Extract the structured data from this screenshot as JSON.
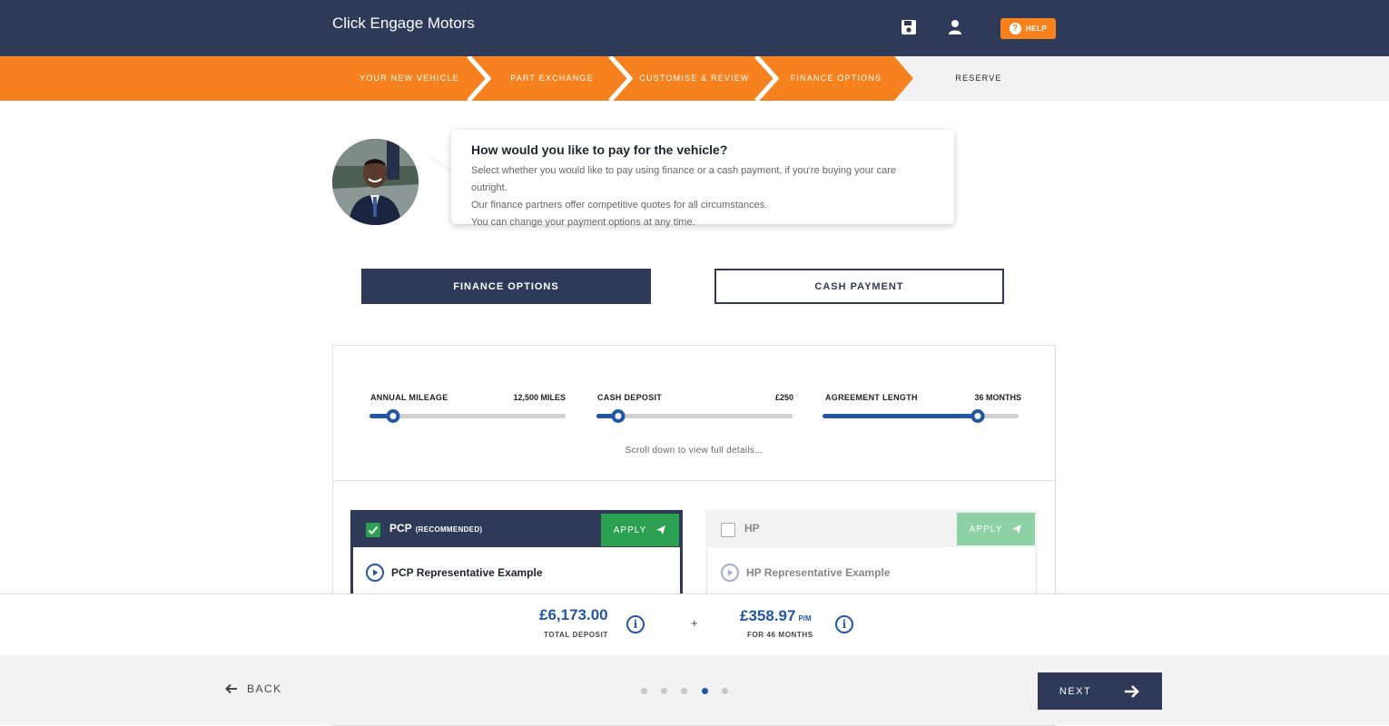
{
  "header": {
    "brand": "Click Engage Motors",
    "help_label": "HELP",
    "help_icon": "?"
  },
  "stepper": {
    "steps": [
      {
        "label": "YOUR NEW VEHICLE",
        "state": "done"
      },
      {
        "label": "PART EXCHANGE",
        "state": "done"
      },
      {
        "label": "CUSTOMISE & REVIEW",
        "state": "done"
      },
      {
        "label": "FINANCE OPTIONS",
        "state": "done"
      },
      {
        "label": "RESERVE",
        "state": "current"
      }
    ]
  },
  "intro": {
    "title": "How would you like to pay for the vehicle?",
    "lines": [
      "Select whether you would like to pay using finance or a cash payment, if you're buying your care outright.",
      "Our finance partners offer competitive quotes for all circumstances.",
      "You can change your payment options at any time."
    ]
  },
  "payment_toggle": {
    "finance_label": "FINANCE OPTIONS",
    "cash_label": "CASH PAYMENT",
    "selected": "finance"
  },
  "sliders": [
    {
      "label": "ANNUAL MILEAGE",
      "value": "12,500 MILES",
      "fraction": 0.12
    },
    {
      "label": "CASH DEPOSIT",
      "value": "£250",
      "fraction": 0.11
    },
    {
      "label": "AGREEMENT LENGTH",
      "value": "36 MONTHS",
      "fraction": 0.79
    }
  ],
  "scroll_hint": "Scroll down to view full details...",
  "finance_cards": {
    "pcp": {
      "title": "PCP",
      "badge": "(RECOMMENDED)",
      "apply_label": "APPLY",
      "rep_label": "PCP Representative Example",
      "checked": true
    },
    "hp": {
      "title": "HP",
      "apply_label": "APPLY",
      "rep_label": "HP Representative Example",
      "checked": false
    }
  },
  "summary": {
    "deposit_amount": "£6,173.00",
    "deposit_label": "TOTAL DEPOSIT",
    "plus": "+",
    "monthly_amount": "£358.97",
    "monthly_unit": "P/M",
    "monthly_label": "FOR 46 MONTHS",
    "info_glyph": "i"
  },
  "footer": {
    "back_label": "BACK",
    "next_label": "NEXT",
    "page_count": 5,
    "current_page": 4
  },
  "colors": {
    "navy": "#2e3a57",
    "orange": "#f5821f",
    "blue": "#2356a5",
    "green": "#2aa050"
  }
}
